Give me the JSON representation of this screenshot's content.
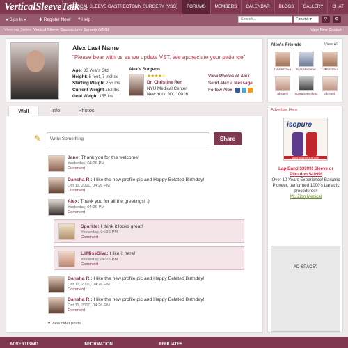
{
  "brand": {
    "logo_main": "VerticalSleeveTalk",
    "logo_sub": ".com"
  },
  "topnav": [
    {
      "label": "VERTICAL SLEEVE GASTRECTOMY SURGERY (VSG)"
    },
    {
      "label": "FORUMS",
      "active": true
    },
    {
      "label": "MEMBERS"
    },
    {
      "label": "CALENDAR"
    },
    {
      "label": "BLOGS"
    },
    {
      "label": "GALLERY"
    },
    {
      "label": "CHAT"
    }
  ],
  "userbar": {
    "sign_in": "Sign In",
    "register": "Register Now!",
    "help": "Help",
    "search_placeholder": "Search...",
    "search_scope": "Forums"
  },
  "breadcrumb": {
    "home": "View our Series",
    "current": "Vertical Sleeve Gastrectomy Surgery (VSG)",
    "new_content": "View New Content"
  },
  "profile": {
    "name": "Alex Last Name",
    "quote": "\"Please bear with us as we update VST. We appreciate your patience\"",
    "stats": [
      {
        "label": "Age:",
        "value": "33 Years Old"
      },
      {
        "label": "Height:",
        "value": "5 feet, 7 inches"
      },
      {
        "label": "Starting Weight",
        "value": "255 lbs"
      },
      {
        "label": "Current Weight",
        "value": "152 lbs"
      },
      {
        "label": "Goal Weight",
        "value": "155 lbs"
      }
    ],
    "surgeon_heading": "Alex's Surgeon",
    "surgeon_rating": 4,
    "surgeon_stars": "★★★★☆",
    "surgeon_name": "Dr. Christine Ren",
    "surgeon_center": "NYU Medical Center",
    "surgeon_location": "New York, NY, 10016",
    "actions": [
      "View Photos of Alex",
      "Send Alex a Message",
      "Follow Alex"
    ]
  },
  "friends": {
    "heading": "Alex's Friends",
    "view_all": "View All",
    "items": [
      {
        "name": "LilMissDiva"
      },
      {
        "name": "MacMadame"
      },
      {
        "name": "LilMissDiva"
      },
      {
        "name": "abraeili"
      },
      {
        "name": "sopranoreplonc"
      },
      {
        "name": "abraeili"
      }
    ]
  },
  "tabs": [
    {
      "label": "Wall",
      "active": true
    },
    {
      "label": "Info"
    },
    {
      "label": "Photos"
    }
  ],
  "composer": {
    "placeholder": "Write Something",
    "button": "Share"
  },
  "posts": [
    {
      "author": "Jane:",
      "text": "Thank you for the welcome!",
      "date": "Yesterday, 04:26 PM",
      "comment": "Comment",
      "highlight": false
    },
    {
      "author": "Dansha R.:",
      "text": "I like the new profile pic and Happy Belated Birthday!",
      "date": "Oct 11, 2010, 04:26 PM",
      "comment": "Comment",
      "highlight": false
    },
    {
      "author": "Alex:",
      "text": "Thank you for all the greetings! :)",
      "date": "Yesterday, 04:26 PM",
      "comment": "Comment",
      "highlight": false
    },
    {
      "author": "Sparkle:",
      "text": "I think it looks great!",
      "date": "Yesterday, 04:26 PM",
      "comment": "Comment",
      "highlight": true
    },
    {
      "author": "LilMissDiva:",
      "text": "I like it here!",
      "date": "Yesterday, 04:26 PM",
      "comment": "Comment",
      "highlight": true
    },
    {
      "author": "Dansha R.:",
      "text": "I like the new profile pic and Happy Belated Birthday!",
      "date": "Oct 11, 2010, 04:26 PM",
      "comment": "Comment",
      "highlight": false
    },
    {
      "author": "Dansha R.:",
      "text": "I like the new profile pic and Happy Belated Birthday!",
      "date": "Oct 11, 2010, 04:26 PM",
      "comment": "Comment",
      "highlight": false
    }
  ],
  "older_posts": "View older posts",
  "sidebar_ad": {
    "heading": "Advertise Here",
    "brand": "isopure",
    "product_url": "www.isopureplus.com",
    "title": "Lap-Band $3999! Sleeve or Plication $4999!",
    "body": "Over 10 Years Experience! Bariatric Pioneer, performed 1000's bariatric procedures!!",
    "link": "Mt. Zion Medical",
    "ad_space": "AD SPACE?"
  },
  "footer": [
    "ADVERTISING",
    "INFORMATION",
    "AFFILIATES"
  ],
  "colors": {
    "brand": "#7f3850",
    "accent_red": "#c0354a",
    "highlight": "#f4e5e9"
  }
}
